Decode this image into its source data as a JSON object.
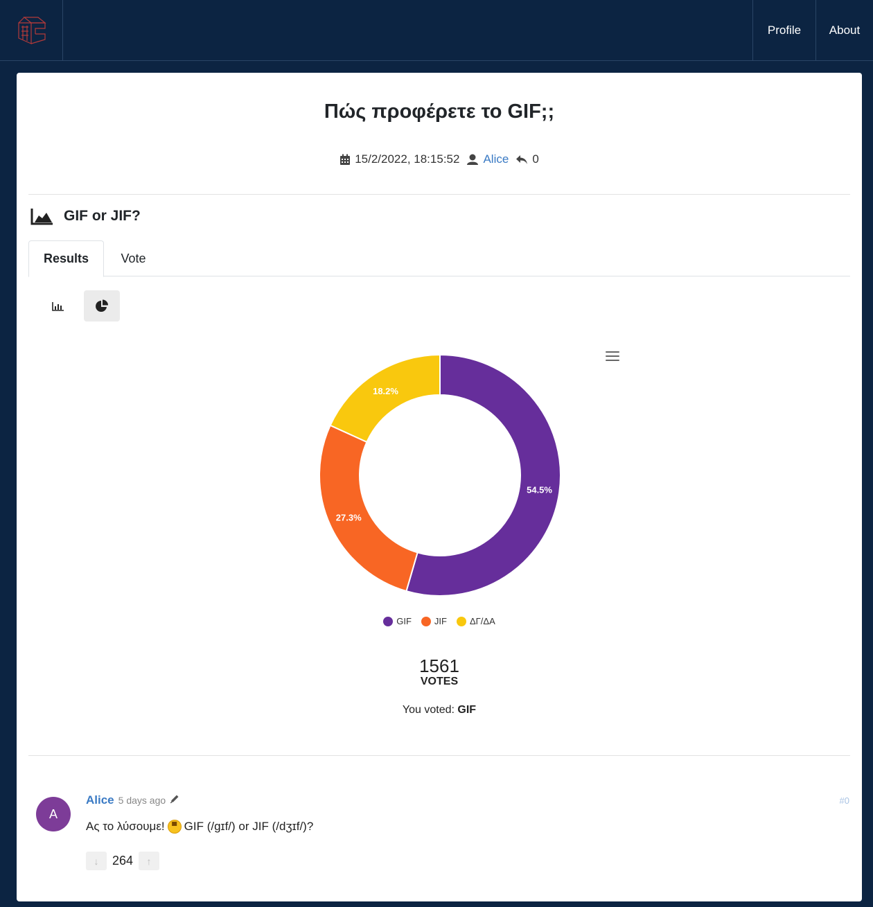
{
  "nav": {
    "logo_icon": "site-logo-icon",
    "links": [
      "Profile",
      "About"
    ]
  },
  "post": {
    "title": "Πώς προφέρετε το GIF;;",
    "date": "15/2/2022, 18:15:52",
    "author": "Alice",
    "replies": "0"
  },
  "poll": {
    "title": "GIF or JIF?",
    "tabs": [
      "Results",
      "Vote"
    ],
    "active_tab": "Results",
    "view_mode": "pie",
    "total_votes": "1561",
    "votes_label": "VOTES",
    "you_voted_label": "You voted:",
    "you_voted_value": "GIF"
  },
  "chart_data": {
    "type": "pie",
    "variant": "donut",
    "categories": [
      "GIF",
      "JIF",
      "ΔΓ/ΔΑ"
    ],
    "values": [
      54.5,
      27.3,
      18.2
    ],
    "data_labels": [
      "54.5%",
      "27.3%",
      "18.2%"
    ],
    "colors": [
      "#662e9b",
      "#f86624",
      "#f9c80e"
    ],
    "legend_position": "bottom"
  },
  "comment": {
    "avatar_letter": "A",
    "author": "Alice",
    "time": "5 days ago",
    "number": "#0",
    "text_before": "Ας το λύσουμε!",
    "text_after": "GIF (/ɡɪf/) or JIF (/dʒɪf/)?",
    "score": "264"
  }
}
